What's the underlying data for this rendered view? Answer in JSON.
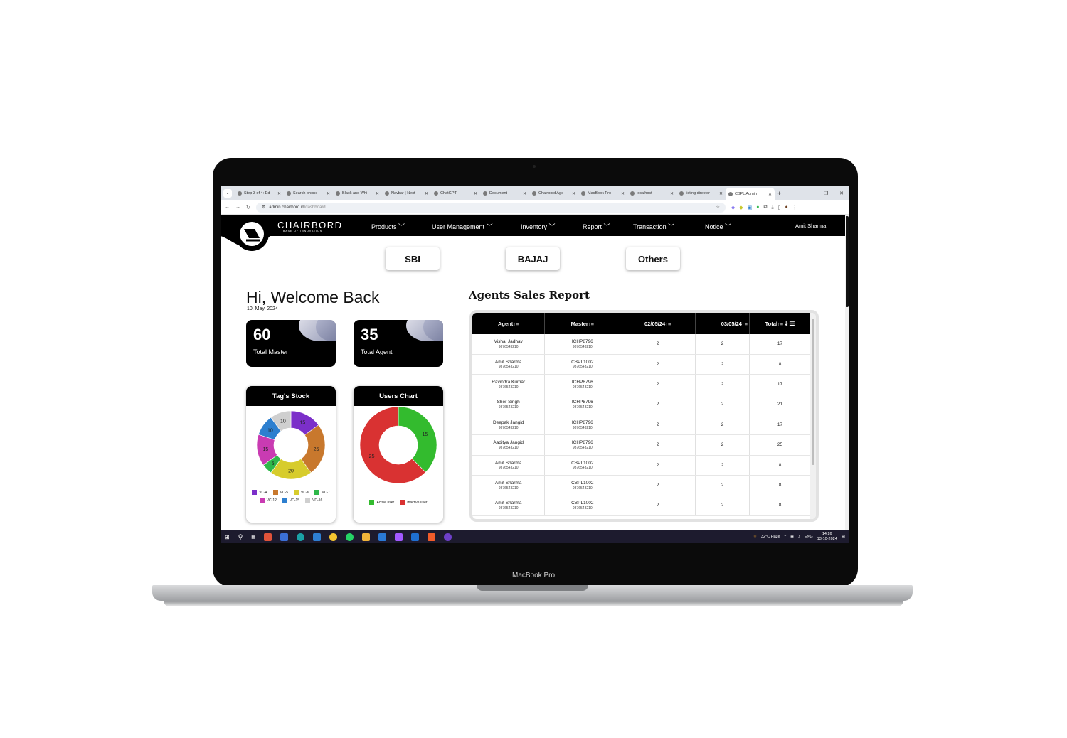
{
  "browser": {
    "tabs": [
      {
        "label": "Step 3 of 4: Ed"
      },
      {
        "label": "Search phone"
      },
      {
        "label": "Black and Whi"
      },
      {
        "label": "Navbar | Next"
      },
      {
        "label": "ChatGPT"
      },
      {
        "label": "Document"
      },
      {
        "label": "Chairbord Age"
      },
      {
        "label": "MacBook Pro"
      },
      {
        "label": "localhost"
      },
      {
        "label": "listing director"
      },
      {
        "label": "CBPL Admin"
      }
    ],
    "new_tab": "+",
    "url_domain": "admin.chairbord.in",
    "url_path": "/dashboard"
  },
  "app": {
    "brand": "CHAIRBORD",
    "tagline": "BASE OF INNOVATION",
    "nav": [
      {
        "label": "Products"
      },
      {
        "label": "User Management"
      },
      {
        "label": "Inventory"
      },
      {
        "label": "Report"
      },
      {
        "label": "Transaction"
      },
      {
        "label": "Notice"
      }
    ],
    "user_name": "Amit Sharma"
  },
  "banks": [
    {
      "label": "SBI"
    },
    {
      "label": "BAJAJ"
    },
    {
      "label": "Others"
    }
  ],
  "welcome": {
    "title": "Hi, Welcome Back",
    "date": "10, May, 2024"
  },
  "stats": [
    {
      "value": "60",
      "label": "Total Master"
    },
    {
      "value": "35",
      "label": "Total Agent"
    }
  ],
  "tags_stock": {
    "title": "Tag's Stock",
    "chart_data": {
      "type": "pie",
      "categories": [
        "VC-4",
        "VC-5",
        "VC-6",
        "VC-7",
        "VC-12",
        "VC-15",
        "VC-16"
      ],
      "values": [
        15,
        25,
        20,
        5,
        15,
        10,
        10
      ],
      "colors": [
        "#7b2fc9",
        "#c8782d",
        "#d7cc2c",
        "#2fb84a",
        "#c93bb2",
        "#2d7fcf",
        "#cfcfcf"
      ]
    }
  },
  "users_chart": {
    "title": "Users Chart",
    "chart_data": {
      "type": "pie",
      "categories": [
        "Active user",
        "Inactive user"
      ],
      "values": [
        15,
        25
      ],
      "colors": [
        "#33bb2e",
        "#d93232"
      ]
    }
  },
  "report": {
    "title": "Agents Sales Report",
    "columns": [
      "Agent",
      "Master",
      "02/05/24",
      "03/05/24",
      "Total"
    ],
    "rows": [
      {
        "agent": "Vishal Jadhav",
        "agent_phone": "9876543210",
        "master": "ICHP8796",
        "master_phone": "9876543210",
        "d1": "2",
        "d2": "2",
        "total": "17"
      },
      {
        "agent": "Amit Sharma",
        "agent_phone": "9876543210",
        "master": "CBPL1002",
        "master_phone": "9876543210",
        "d1": "2",
        "d2": "2",
        "total": "8"
      },
      {
        "agent": "Ravindra Kumar",
        "agent_phone": "9876543210",
        "master": "ICHP8796",
        "master_phone": "9876543210",
        "d1": "2",
        "d2": "2",
        "total": "17"
      },
      {
        "agent": "Sher Singh",
        "agent_phone": "9876543210",
        "master": "ICHP8796",
        "master_phone": "9876543210",
        "d1": "2",
        "d2": "2",
        "total": "21"
      },
      {
        "agent": "Deepak Jangid",
        "agent_phone": "9876543210",
        "master": "ICHP8796",
        "master_phone": "9876543210",
        "d1": "2",
        "d2": "2",
        "total": "17"
      },
      {
        "agent": "Aaditya Jangid",
        "agent_phone": "9876543210",
        "master": "ICHP8796",
        "master_phone": "9876543210",
        "d1": "2",
        "d2": "2",
        "total": "25"
      },
      {
        "agent": "Amit Sharma",
        "agent_phone": "9876543210",
        "master": "CBPL1002",
        "master_phone": "9876543210",
        "d1": "2",
        "d2": "2",
        "total": "8"
      },
      {
        "agent": "Amit Sharma",
        "agent_phone": "9876543210",
        "master": "CBPL1002",
        "master_phone": "9876543210",
        "d1": "2",
        "d2": "2",
        "total": "8"
      },
      {
        "agent": "Amit Sharma",
        "agent_phone": "9876543210",
        "master": "CBPL1002",
        "master_phone": "9876543210",
        "d1": "2",
        "d2": "2",
        "total": "8"
      }
    ]
  },
  "taskbar": {
    "weather": "32°C  Haze",
    "lang": "ENG",
    "time": "14:26",
    "date": "13-10-2024"
  },
  "device_label": "MacBook Pro"
}
